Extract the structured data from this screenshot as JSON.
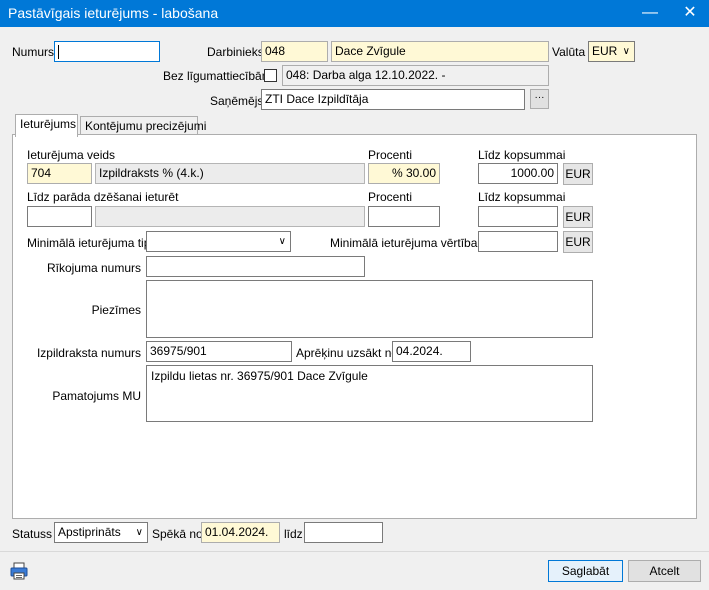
{
  "window": {
    "title": "Pastāvīgais ieturējums - labošana"
  },
  "header": {
    "numurs_label": "Numurs",
    "numurs_value": "",
    "darbinieks_label": "Darbinieks",
    "darbinieks_code": "048",
    "darbinieks_name": "Dace Zvīgule",
    "valuta_label": "Valūta",
    "valuta_value": "EUR",
    "bez_label": "Bez līgumattiecībām",
    "bez_value": "048: Darba alga  12.10.2022. -",
    "sanemejs_label": "Saņēmējs",
    "sanemejs_value": "ZTI Dace Izpildītāja",
    "sanemejs_button": "···"
  },
  "tabs": [
    {
      "label": "Ieturējums"
    },
    {
      "label": "Kontējumu precizējumi"
    }
  ],
  "main": {
    "ieturejuma_veids_label": "Ieturējuma veids",
    "veids_code": "704",
    "veids_name": "Izpildraksts % (4.k.)",
    "procenti_label": "Procenti",
    "procenti_value": "% 30.00",
    "lidz_kopsummai_label": "Līdz kopsummai",
    "lidz_kopsummai_value": "1000.00",
    "currency_button": "EUR",
    "lidz_parada_label": "Līdz parāda dzēšanai ieturēt",
    "lidz_parada_code": "",
    "procenti2_label": "Procenti",
    "procenti2_value": "",
    "lidz_kopsummai2_label": "Līdz kopsummai",
    "lidz_kopsummai2_value": "",
    "min_tips_label": "Minimālā ieturējuma tips",
    "min_tips_value": "",
    "min_vertiba_label": "Minimālā ieturējuma vērtība",
    "min_vertiba_value": "",
    "rikojuma_label": "Rīkojuma numurs",
    "rikojuma_value": "",
    "piezimes_label": "Piezīmes",
    "piezimes_value": "",
    "izpildraksta_label": "Izpildraksta numurs",
    "izpildraksta_value": "36975/901",
    "aprekinu_label": "Aprēķinu uzsākt no",
    "aprekinu_value": "04.2024.",
    "pamatojums_label": "Pamatojums MU",
    "pamatojums_value": "Izpildu lietas nr. 36975/901 Dace Zvīgule"
  },
  "footer": {
    "statuss_label": "Statuss",
    "statuss_value": "Apstiprināts",
    "speka_label": "Spēkā no",
    "speka_value": "01.04.2024.",
    "lidz_label": "līdz",
    "lidz_value": "",
    "save_label": "Saglabāt",
    "cancel_label": "Atcelt"
  },
  "colors": {
    "titlebar": "#0078d7",
    "highlight": "#fff9d6"
  },
  "icons": {
    "print": "printer-icon",
    "close": "close-icon",
    "minimize": "minimize-icon"
  }
}
